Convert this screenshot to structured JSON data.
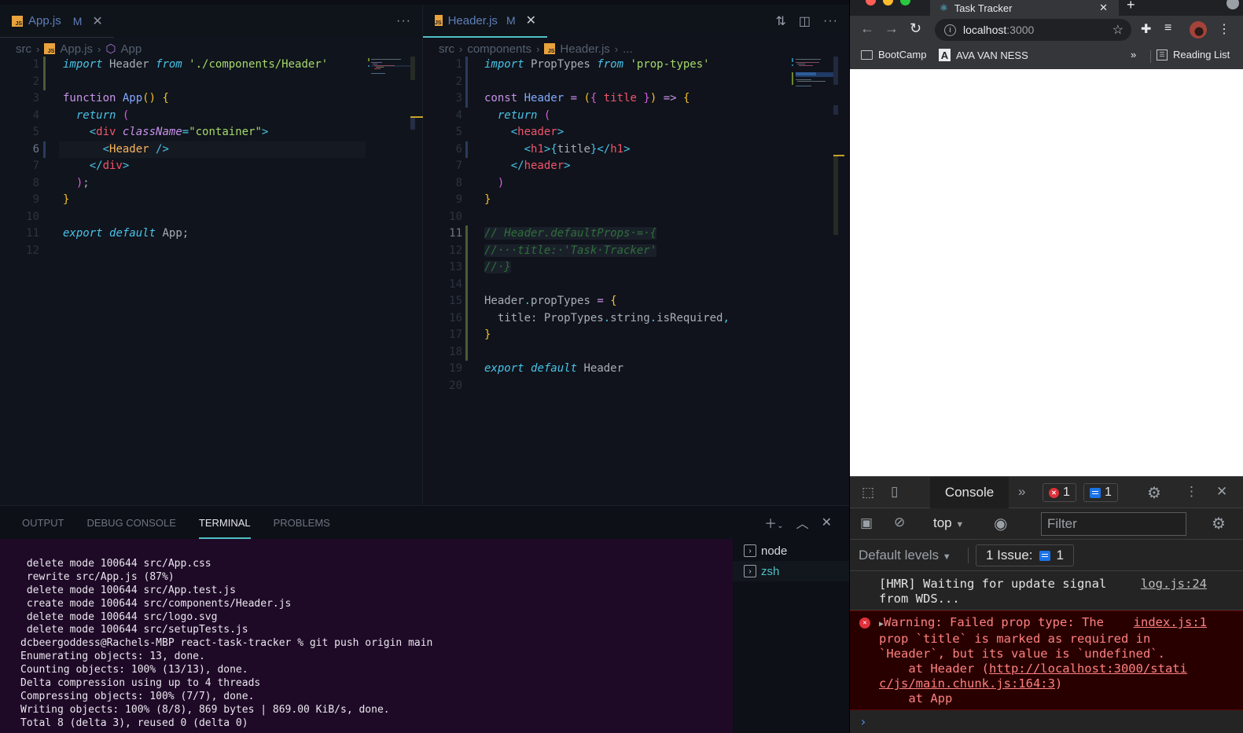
{
  "editor_left": {
    "tab": {
      "icon": "js-file-icon",
      "label": "App.js",
      "status": "M"
    },
    "breadcrumb": [
      "src",
      "App.js",
      "App"
    ],
    "lines": [
      {
        "n": "1",
        "tokens": [
          [
            "kw-i",
            "import"
          ],
          [
            "id",
            " Header "
          ],
          [
            "kw-i",
            "from"
          ],
          [
            "id",
            " "
          ],
          [
            "str",
            "'./components/Header'"
          ]
        ]
      },
      {
        "n": "2",
        "tokens": []
      },
      {
        "n": "3",
        "tokens": [
          [
            "kw",
            "function"
          ],
          [
            "id",
            " "
          ],
          [
            "fn",
            "App"
          ],
          [
            "br-y",
            "()"
          ],
          [
            "id",
            " "
          ],
          [
            "br-y",
            "{"
          ]
        ]
      },
      {
        "n": "4",
        "tokens": [
          [
            "id",
            "  "
          ],
          [
            "kw-i",
            "return"
          ],
          [
            "id",
            " "
          ],
          [
            "br-p",
            "("
          ]
        ]
      },
      {
        "n": "5",
        "tokens": [
          [
            "id",
            "    "
          ],
          [
            "punct",
            "<"
          ],
          [
            "tag",
            "div"
          ],
          [
            "id",
            " "
          ],
          [
            "attr",
            "className"
          ],
          [
            "punct",
            "="
          ],
          [
            "str",
            "\"container\""
          ],
          [
            "punct",
            ">"
          ]
        ]
      },
      {
        "n": "6",
        "tokens": [
          [
            "id",
            "      "
          ],
          [
            "punct",
            "<"
          ],
          [
            "cmp",
            "Header"
          ],
          [
            "id",
            " "
          ],
          [
            "punct",
            "/>"
          ]
        ]
      },
      {
        "n": "7",
        "tokens": [
          [
            "id",
            "    "
          ],
          [
            "punct",
            "</"
          ],
          [
            "tag",
            "div"
          ],
          [
            "punct",
            ">"
          ]
        ]
      },
      {
        "n": "8",
        "tokens": [
          [
            "id",
            "  "
          ],
          [
            "br-p",
            ")"
          ],
          [
            "id",
            ";"
          ]
        ]
      },
      {
        "n": "9",
        "tokens": [
          [
            "br-y",
            "}"
          ]
        ]
      },
      {
        "n": "10",
        "tokens": []
      },
      {
        "n": "11",
        "tokens": [
          [
            "kw-i",
            "export"
          ],
          [
            "id",
            " "
          ],
          [
            "kw-i",
            "default"
          ],
          [
            "id",
            " App;"
          ]
        ]
      },
      {
        "n": "12",
        "tokens": []
      }
    ]
  },
  "editor_right": {
    "tab": {
      "icon": "js-file-icon",
      "label": "Header.js",
      "status": "M"
    },
    "breadcrumb": [
      "src",
      "components",
      "Header.js",
      "..."
    ],
    "lines": [
      {
        "n": "1",
        "tokens": [
          [
            "kw-i",
            "import"
          ],
          [
            "id",
            " PropTypes "
          ],
          [
            "kw-i",
            "from"
          ],
          [
            "id",
            " "
          ],
          [
            "str",
            "'prop-types'"
          ]
        ]
      },
      {
        "n": "2",
        "tokens": []
      },
      {
        "n": "3",
        "tokens": [
          [
            "kw",
            "const"
          ],
          [
            "id",
            " "
          ],
          [
            "fn",
            "Header"
          ],
          [
            "id",
            " "
          ],
          [
            "op",
            "="
          ],
          [
            "id",
            " "
          ],
          [
            "br-y",
            "("
          ],
          [
            "br-p",
            "{"
          ],
          [
            "id",
            " "
          ],
          [
            "prop-p",
            "title"
          ],
          [
            "id",
            " "
          ],
          [
            "br-p",
            "}"
          ],
          [
            "br-y",
            ")"
          ],
          [
            "id",
            " "
          ],
          [
            "op",
            "=>"
          ],
          [
            "id",
            " "
          ],
          [
            "br-y",
            "{"
          ]
        ]
      },
      {
        "n": "4",
        "tokens": [
          [
            "id",
            "  "
          ],
          [
            "kw-i",
            "return"
          ],
          [
            "id",
            " "
          ],
          [
            "br-p",
            "("
          ]
        ]
      },
      {
        "n": "5",
        "tokens": [
          [
            "id",
            "    "
          ],
          [
            "punct",
            "<"
          ],
          [
            "tag",
            "header"
          ],
          [
            "punct",
            ">"
          ]
        ]
      },
      {
        "n": "6",
        "tokens": [
          [
            "id",
            "      "
          ],
          [
            "punct",
            "<"
          ],
          [
            "tag",
            "h1"
          ],
          [
            "punct",
            ">"
          ],
          [
            "br-b",
            "{"
          ],
          [
            "id",
            "title"
          ],
          [
            "br-b",
            "}"
          ],
          [
            "punct",
            "</"
          ],
          [
            "tag",
            "h1"
          ],
          [
            "punct",
            ">"
          ]
        ]
      },
      {
        "n": "7",
        "tokens": [
          [
            "id",
            "    "
          ],
          [
            "punct",
            "</"
          ],
          [
            "tag",
            "header"
          ],
          [
            "punct",
            ">"
          ]
        ]
      },
      {
        "n": "8",
        "tokens": [
          [
            "id",
            "  "
          ],
          [
            "br-p",
            ")"
          ]
        ]
      },
      {
        "n": "9",
        "tokens": [
          [
            "br-y",
            "}"
          ]
        ]
      },
      {
        "n": "10",
        "tokens": []
      },
      {
        "n": "11",
        "tokens": [
          [
            "cmt",
            "// Header.defaultProps·=·{"
          ]
        ]
      },
      {
        "n": "12",
        "tokens": [
          [
            "cmt",
            "//···title:·'Task·Tracker'"
          ]
        ]
      },
      {
        "n": "13",
        "tokens": [
          [
            "cmt",
            "//·}"
          ]
        ]
      },
      {
        "n": "14",
        "tokens": []
      },
      {
        "n": "15",
        "tokens": [
          [
            "id",
            "Header"
          ],
          [
            "punct",
            "."
          ],
          [
            "id",
            "propTypes "
          ],
          [
            "op",
            "="
          ],
          [
            "id",
            " "
          ],
          [
            "br-y",
            "{"
          ]
        ]
      },
      {
        "n": "16",
        "tokens": [
          [
            "id",
            "  title: PropTypes"
          ],
          [
            "punct",
            "."
          ],
          [
            "id",
            "string"
          ],
          [
            "punct",
            "."
          ],
          [
            "id",
            "isRequired"
          ],
          [
            "punct",
            ","
          ]
        ]
      },
      {
        "n": "17",
        "tokens": [
          [
            "br-y",
            "}"
          ]
        ]
      },
      {
        "n": "18",
        "tokens": []
      },
      {
        "n": "19",
        "tokens": [
          [
            "kw-i",
            "export"
          ],
          [
            "id",
            " "
          ],
          [
            "kw-i",
            "default"
          ],
          [
            "id",
            " Header"
          ]
        ]
      },
      {
        "n": "20",
        "tokens": []
      }
    ]
  },
  "panel": {
    "tabs": [
      "OUTPUT",
      "DEBUG CONSOLE",
      "TERMINAL",
      "PROBLEMS"
    ],
    "active_tab": "TERMINAL",
    "terminal_lines": [
      " delete mode 100644 src/App.css",
      " rewrite src/App.js (87%)",
      " delete mode 100644 src/App.test.js",
      " create mode 100644 src/components/Header.js",
      " delete mode 100644 src/logo.svg",
      " delete mode 100644 src/setupTests.js",
      "dcbeergoddess@Rachels-MBP react-task-tracker % git push origin main",
      "Enumerating objects: 13, done.",
      "Counting objects: 100% (13/13), done.",
      "Delta compression using up to 4 threads",
      "Compressing objects: 100% (7/7), done.",
      "Writing objects: 100% (8/8), 869 bytes | 869.00 KiB/s, done.",
      "Total 8 (delta 3), reused 0 (delta 0)"
    ],
    "terminals": [
      {
        "label": "node",
        "active": false
      },
      {
        "label": "zsh",
        "active": true
      }
    ]
  },
  "browser": {
    "tab_title": "Task Tracker",
    "url_host": "localhost",
    "url_port": ":3000",
    "bookmarks": [
      "BootCamp",
      "AVA VAN NESS"
    ],
    "reading_list": "Reading List",
    "devtools": {
      "console_tab": "Console",
      "error_count": "1",
      "message_count": "1",
      "context": "top",
      "filter_placeholder": "Filter",
      "levels": "Default levels",
      "issues_label": "1 Issue:",
      "issues_count": "1",
      "log": {
        "text": "[HMR] Waiting for update signal from WDS...",
        "source": "log.js:24"
      },
      "error": {
        "line1": "Warning: Failed prop type: The",
        "source": "index.js:1",
        "line2": "prop `title` is marked as required in",
        "line3": "`Header`, but its value is `undefined`.",
        "line4_pre": "    at Header (",
        "url_part1": "http://localhost:3000/stati",
        "url_part2": "c/js/main.chunk.js:164:3",
        "line5_post": ")",
        "line6": "    at App"
      }
    }
  }
}
